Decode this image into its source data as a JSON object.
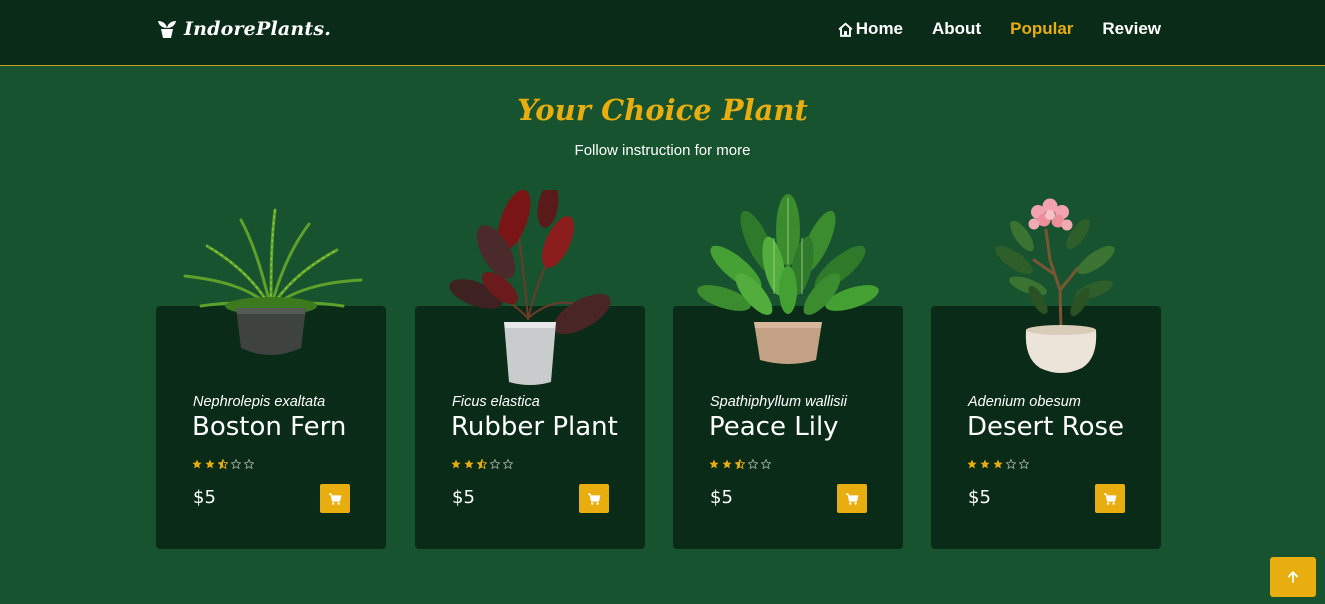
{
  "header": {
    "brand": "IndorePlants.",
    "nav": [
      {
        "label": "Home",
        "active": false,
        "icon": "home-icon"
      },
      {
        "label": "About",
        "active": false
      },
      {
        "label": "Popular",
        "active": true
      },
      {
        "label": "Review",
        "active": false
      }
    ]
  },
  "section": {
    "title": "Your Choice Plant",
    "subtitle": "Follow instruction for more"
  },
  "products": [
    {
      "scientific": "Nephrolepis exaltata",
      "name": "Boston Fern",
      "rating": 2.5,
      "max_rating": 5,
      "price": "$5",
      "image": "fern-plant-image"
    },
    {
      "scientific": "Ficus elastica",
      "name": "Rubber Plant",
      "rating": 2.5,
      "max_rating": 5,
      "price": "$5",
      "image": "rubber-plant-image"
    },
    {
      "scientific": "Spathiphyllum wallisii",
      "name": "Peace Lily",
      "rating": 2.5,
      "max_rating": 5,
      "price": "$5",
      "image": "peace-lily-image"
    },
    {
      "scientific": "Adenium obesum",
      "name": "Desert Rose",
      "rating": 3,
      "max_rating": 5,
      "price": "$5",
      "image": "desert-rose-image"
    }
  ],
  "colors": {
    "background": "#17532f",
    "header_bg": "#0a2b17",
    "card_bg": "#0a2b17",
    "accent": "#e8ad0e",
    "text": "#ffffff"
  },
  "icons": {
    "brand": "leaf-pot-icon",
    "cart": "cart-icon",
    "scroll_top": "arrow-up-icon",
    "star_full": "star-full-icon",
    "star_half": "star-half-icon",
    "star_empty": "star-empty-icon"
  }
}
